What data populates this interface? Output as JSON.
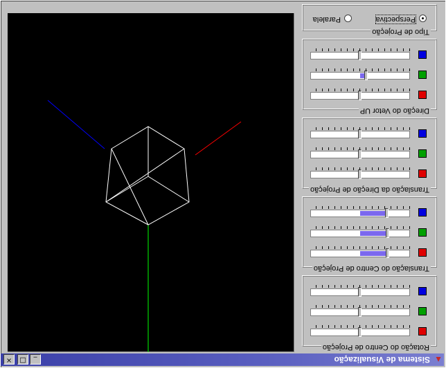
{
  "window": {
    "title": "Sistema de Visualização",
    "minimize_glyph": "_",
    "maximize_glyph": "□",
    "close_glyph": "×",
    "app_icon": "app-window-icon"
  },
  "viewport": {
    "background": "#000000",
    "axis_colors": {
      "x": "#ff0000",
      "y": "#00ff00",
      "z": "#0000ff"
    },
    "wireframe_color": "#ffffff"
  },
  "panels": {
    "rotation_center": {
      "legend": "Rotação do Centro de Projeção",
      "sliders": [
        {
          "axis": "x",
          "color": "red",
          "value": 0.5
        },
        {
          "axis": "y",
          "color": "green",
          "value": 0.5
        },
        {
          "axis": "z",
          "color": "blue",
          "value": 0.5
        }
      ]
    },
    "translation_center": {
      "legend": "Translação do Centro de Projeção",
      "sliders": [
        {
          "axis": "x",
          "color": "red",
          "value": 0.22
        },
        {
          "axis": "y",
          "color": "green",
          "value": 0.22
        },
        {
          "axis": "z",
          "color": "blue",
          "value": 0.23
        }
      ]
    },
    "translation_direction": {
      "legend": "Translação da Direção de Projeção",
      "sliders": [
        {
          "axis": "x",
          "color": "red",
          "value": 0.5
        },
        {
          "axis": "y",
          "color": "green",
          "value": 0.5
        },
        {
          "axis": "z",
          "color": "blue",
          "value": 0.5
        }
      ]
    },
    "up_vector": {
      "legend": "Direção do Vetor UP",
      "sliders": [
        {
          "axis": "x",
          "color": "red",
          "value": 0.5
        },
        {
          "axis": "y",
          "color": "green",
          "value": 0.44
        },
        {
          "axis": "z",
          "color": "blue",
          "value": 0.5
        }
      ]
    },
    "projection_type": {
      "legend": "Tipo de Projeção",
      "options": [
        {
          "label": "Perspectiva",
          "selected": true
        },
        {
          "label": "Paralela",
          "selected": false
        }
      ]
    }
  }
}
